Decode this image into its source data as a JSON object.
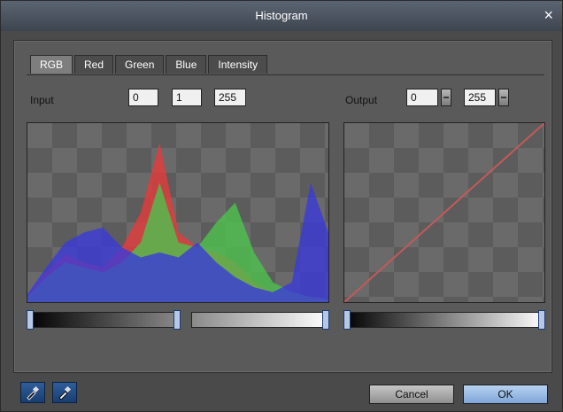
{
  "window": {
    "title": "Histogram",
    "close_glyph": "×"
  },
  "tabs": [
    "RGB",
    "Red",
    "Green",
    "Blue",
    "Intensity"
  ],
  "active_tab": 0,
  "input": {
    "label": "Input",
    "black": "0",
    "gamma": "1",
    "white": "255"
  },
  "output": {
    "label": "Output",
    "black": "0",
    "white": "255"
  },
  "buttons": {
    "cancel": "Cancel",
    "ok": "OK"
  },
  "icons": {
    "eyedropper_black": "eyedropper-icon",
    "eyedropper_white": "eyedropper-icon"
  },
  "colors": {
    "red": "#e53b3b",
    "green": "#4ec24e",
    "blue": "#3b3bd9",
    "teal": "#2f6f8a",
    "curve": "#c25a5a"
  },
  "chart_data": {
    "type": "area",
    "x": [
      0,
      16,
      32,
      48,
      64,
      80,
      96,
      112,
      128,
      144,
      160,
      176,
      192,
      208,
      224,
      240,
      255
    ],
    "series": [
      {
        "values": [
          5,
          30,
          48,
          40,
          35,
          55,
          90,
          160,
          70,
          55,
          50,
          40,
          20,
          10,
          8,
          5,
          3
        ]
      },
      {
        "values": [
          5,
          25,
          40,
          35,
          30,
          40,
          60,
          120,
          60,
          55,
          80,
          100,
          50,
          20,
          10,
          5,
          3
        ]
      },
      {
        "values": [
          8,
          35,
          60,
          70,
          75,
          55,
          45,
          50,
          45,
          60,
          40,
          25,
          15,
          10,
          20,
          120,
          70
        ]
      }
    ]
  }
}
